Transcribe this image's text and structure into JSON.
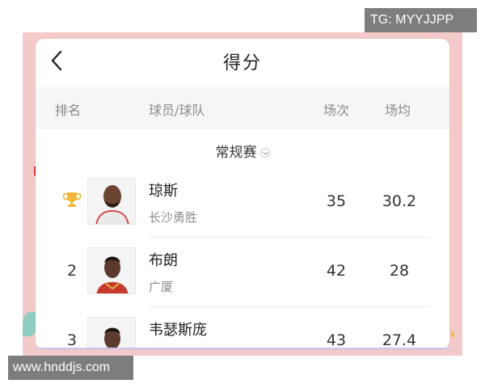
{
  "header": {
    "back_icon": "chevron-left-icon",
    "title": "得分"
  },
  "table_header": {
    "rank": "排名",
    "player_team": "球员/球队",
    "games": "场次",
    "average": "场均"
  },
  "filter": {
    "season": "常规赛",
    "caret_icon": "chevron-down-icon"
  },
  "rows": [
    {
      "rank": "",
      "rank_icon": "trophy-icon",
      "name": "琼斯",
      "team": "长沙勇胜",
      "games": "35",
      "average": "30.2"
    },
    {
      "rank": "2",
      "name": "布朗",
      "team": "广厦",
      "games": "42",
      "average": "28"
    },
    {
      "rank": "3",
      "name": "韦瑟斯庞",
      "team": "",
      "games": "43",
      "average": "27.4"
    }
  ],
  "watermarks": {
    "telegram": "TG: MYYJJPP",
    "site": "www.hnddjs.com"
  },
  "colors": {
    "frame": "#f3c9c9",
    "trophy": "#f1b73a",
    "header_bg": "#f6f6f8"
  }
}
